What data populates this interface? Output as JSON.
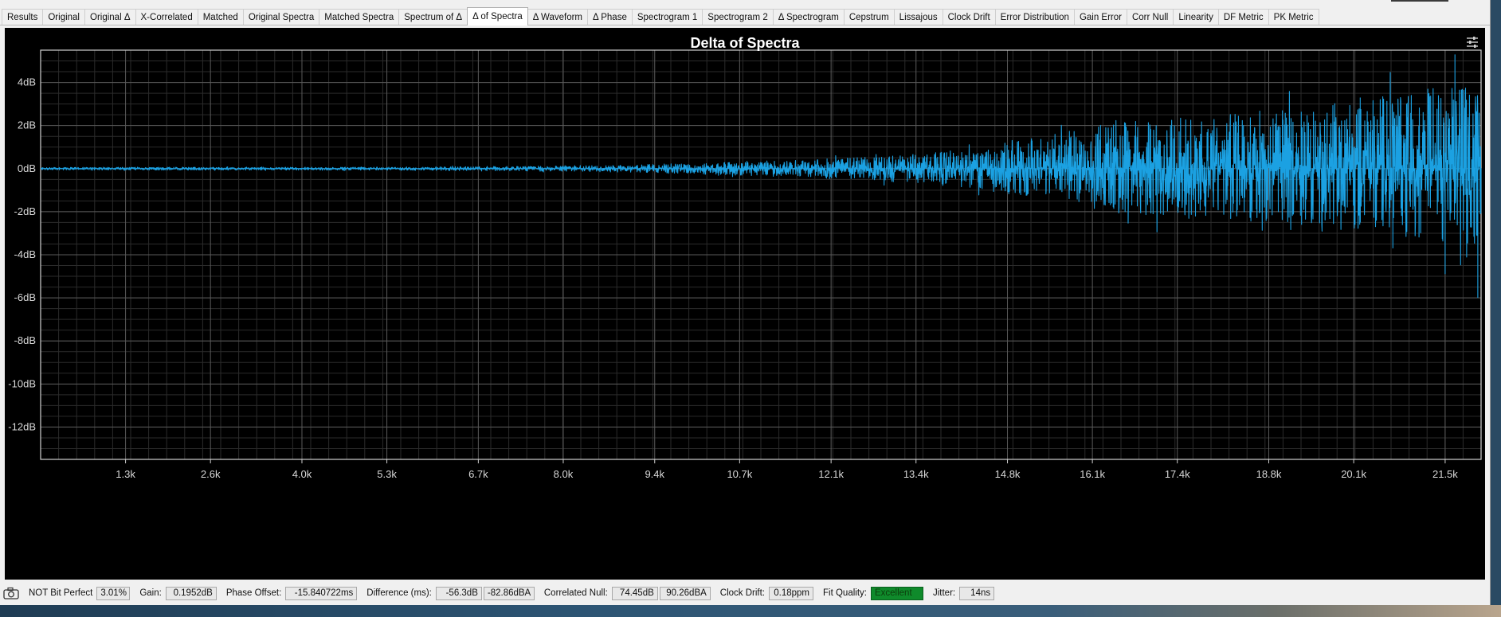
{
  "tabs": [
    {
      "label": "Results",
      "w": 44
    },
    {
      "label": "Original",
      "w": 50
    },
    {
      "label": "Original Δ",
      "w": 58
    },
    {
      "label": "X-Correlated",
      "w": 72
    },
    {
      "label": "Matched",
      "w": 53
    },
    {
      "label": "Original Spectra",
      "w": 87
    },
    {
      "label": "Matched Spectra",
      "w": 92
    },
    {
      "label": "Spectrum of Δ",
      "w": 79
    },
    {
      "label": "Δ of Spectra",
      "w": 72,
      "active": true
    },
    {
      "label": "Δ Waveform",
      "w": 71
    },
    {
      "label": "Δ Phase",
      "w": 54
    },
    {
      "label": "Spectrogram 1",
      "w": 81
    },
    {
      "label": "Spectrogram 2",
      "w": 81
    },
    {
      "label": "Δ Spectrogram",
      "w": 82
    },
    {
      "label": "Cepstrum",
      "w": 57
    },
    {
      "label": "Lissajous",
      "w": 55
    },
    {
      "label": "Clock Drift",
      "w": 61
    },
    {
      "label": "Error Distribution",
      "w": 89
    },
    {
      "label": "Gain Error",
      "w": 60
    },
    {
      "label": "Corr Null",
      "w": 52
    },
    {
      "label": "Linearity",
      "w": 51
    },
    {
      "label": "DF Metric",
      "w": 58
    },
    {
      "label": "PK Metric",
      "w": 56
    }
  ],
  "chart_data": {
    "type": "line",
    "title": "Delta of Spectra",
    "xlabel": "",
    "ylabel": "",
    "xlim": [
      0,
      22050
    ],
    "ylim": [
      -13.5,
      5.5
    ],
    "x_ticks": [
      "1.3k",
      "2.6k",
      "4.0k",
      "5.3k",
      "6.7k",
      "8.0k",
      "9.4k",
      "10.7k",
      "12.1k",
      "13.4k",
      "14.8k",
      "16.1k",
      "17.4k",
      "18.8k",
      "20.1k",
      "21.5k"
    ],
    "x_tick_values": [
      1300,
      2600,
      4000,
      5300,
      6700,
      8000,
      9400,
      10700,
      12100,
      13400,
      14800,
      16100,
      17400,
      18800,
      20100,
      21500
    ],
    "y_ticks": [
      "4dB",
      "2dB",
      "0dB",
      "-2dB",
      "-4dB",
      "-6dB",
      "-8dB",
      "-10dB",
      "-12dB"
    ],
    "y_tick_values": [
      4,
      2,
      0,
      -2,
      -4,
      -6,
      -8,
      -10,
      -12
    ],
    "grid": true,
    "line_color": "#1ba1e2",
    "series": [
      {
        "envelope": [
          {
            "x": 0,
            "max": 0.05,
            "min": -0.05
          },
          {
            "x": 2000,
            "max": 0.06,
            "min": -0.06
          },
          {
            "x": 4000,
            "max": 0.06,
            "min": -0.06
          },
          {
            "x": 6000,
            "max": 0.07,
            "min": -0.07
          },
          {
            "x": 7500,
            "max": 0.1,
            "min": -0.1
          },
          {
            "x": 9000,
            "max": 0.15,
            "min": -0.15
          },
          {
            "x": 10500,
            "max": 0.25,
            "min": -0.25
          },
          {
            "x": 11500,
            "max": 0.35,
            "min": -0.35
          },
          {
            "x": 12500,
            "max": 0.45,
            "min": -0.45
          },
          {
            "x": 13500,
            "max": 0.6,
            "min": -0.6
          },
          {
            "x": 14500,
            "max": 0.9,
            "min": -0.9
          },
          {
            "x": 15500,
            "max": 1.4,
            "min": -1.4
          },
          {
            "x": 16500,
            "max": 1.9,
            "min": -1.8
          },
          {
            "x": 17500,
            "max": 2.2,
            "min": -2.0
          },
          {
            "x": 18500,
            "max": 2.3,
            "min": -2.2
          },
          {
            "x": 19500,
            "max": 2.5,
            "min": -2.4
          },
          {
            "x": 20500,
            "max": 2.9,
            "min": -2.6
          },
          {
            "x": 21500,
            "max": 3.4,
            "min": -3.1
          },
          {
            "x": 22050,
            "max": 3.2,
            "min": -3.0
          }
        ],
        "peaks": [
          {
            "x": 21650,
            "y": 5.3
          },
          {
            "x": 21500,
            "y": -4.9
          },
          {
            "x": 22000,
            "y": -6.0
          },
          {
            "x": 20700,
            "y": -3.7
          },
          {
            "x": 20200,
            "y": 3.3
          }
        ]
      }
    ]
  },
  "chart_frame": {
    "icon": "settings-sliders-icon"
  },
  "status": {
    "camera_icon": "camera-icon",
    "bit_perfect_label": "NOT Bit Perfect",
    "bit_perfect_value": "3.01%",
    "gain_label": "Gain:",
    "gain_value": "0.1952dB",
    "phase_label": "Phase Offset:",
    "phase_value": "-15.840722ms",
    "difference_label": "Difference (ms):",
    "difference_value1": "-56.3dB",
    "difference_value2": "-82.86dBA",
    "corr_null_label": "Correlated Null:",
    "corr_null_value1": "74.45dB",
    "corr_null_value2": "90.26dBA",
    "clock_drift_label": "Clock Drift:",
    "clock_drift_value": "0.18ppm",
    "fit_quality_label": "Fit Quality:",
    "fit_quality_value": "Excellent",
    "jitter_label": "Jitter:",
    "jitter_value": "14ns"
  }
}
